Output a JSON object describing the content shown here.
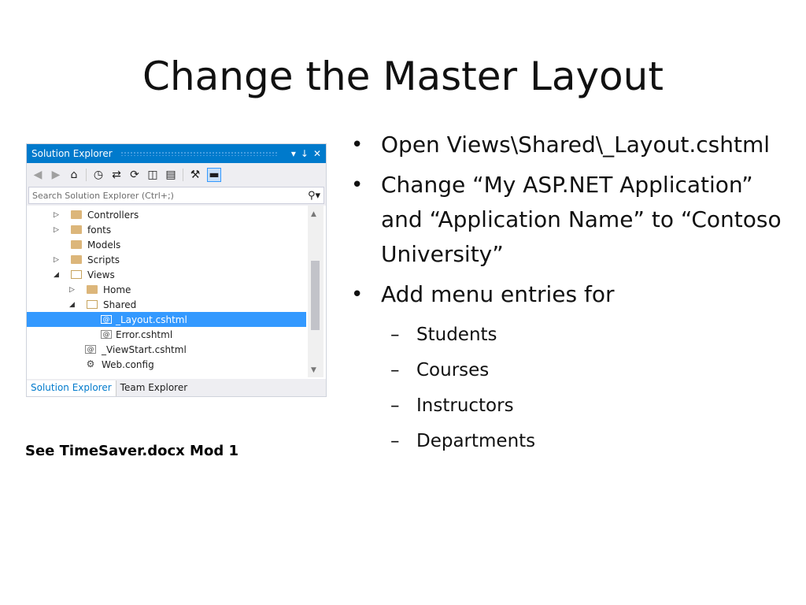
{
  "slide": {
    "title": "Change the Master Layout",
    "bullets": [
      {
        "text": "Open Views\\Shared\\_Layout.cshtml"
      },
      {
        "text": "Change “My ASP.NET Application” and “Application Name” to “Contoso University”"
      },
      {
        "text": "Add menu entries for"
      }
    ],
    "sub_bullets": [
      "Students",
      "Courses",
      "Instructors",
      "Departments"
    ],
    "note": "See TimeSaver.docx Mod 1"
  },
  "solution_explorer": {
    "title": "Solution Explorer",
    "title_controls": [
      "▾",
      "↓",
      "✕"
    ],
    "search_placeholder": "Search Solution Explorer (Ctrl+;)",
    "toolbar_icons": [
      "back-icon",
      "forward-icon",
      "home-icon",
      "pending-changes-icon",
      "sync-icon",
      "refresh-icon",
      "collapse-all-icon",
      "show-all-files-icon",
      "properties-icon",
      "preview-icon"
    ],
    "tree": [
      {
        "label": "Controllers",
        "type": "folder",
        "expander": "▷"
      },
      {
        "label": "fonts",
        "type": "folder",
        "expander": "▷"
      },
      {
        "label": "Models",
        "type": "folder",
        "expander": ""
      },
      {
        "label": "Scripts",
        "type": "folder",
        "expander": "▷"
      },
      {
        "label": "Views",
        "type": "folder-open",
        "expander": "◢"
      },
      {
        "label": "Home",
        "type": "folder",
        "expander": "▷"
      },
      {
        "label": "Shared",
        "type": "folder-open",
        "expander": "◢"
      },
      {
        "label": "_Layout.cshtml",
        "type": "razor",
        "expander": "",
        "selected": true
      },
      {
        "label": "Error.cshtml",
        "type": "razor",
        "expander": ""
      },
      {
        "label": "_ViewStart.cshtml",
        "type": "razor",
        "expander": ""
      },
      {
        "label": "Web.config",
        "type": "config",
        "expander": ""
      }
    ],
    "tabs": [
      "Solution Explorer",
      "Team Explorer"
    ],
    "accent_color": "#007acc",
    "selection_color": "#3399ff"
  }
}
